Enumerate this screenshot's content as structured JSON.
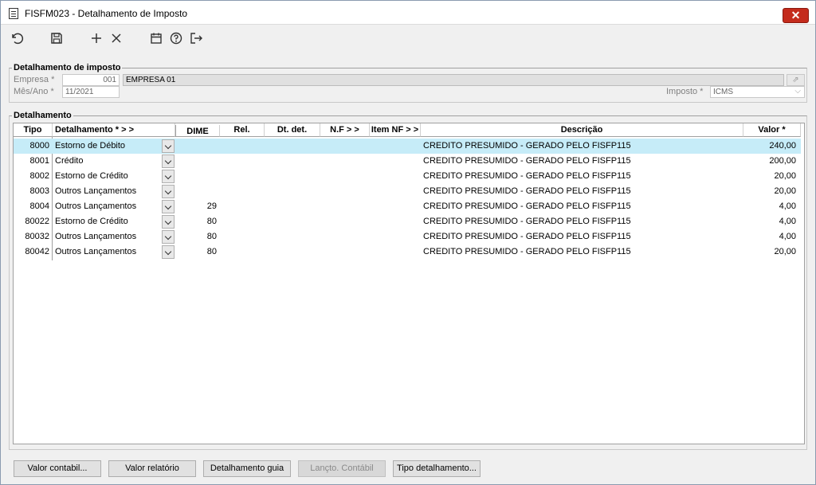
{
  "window": {
    "title": "FISFM023 - Detalhamento de Imposto",
    "close_label": "✕"
  },
  "toolbar": {
    "icons": [
      "undo-icon",
      "save-icon",
      "add-icon",
      "delete-icon",
      "calendar-icon",
      "help-icon",
      "exit-icon"
    ]
  },
  "header_group": {
    "legend": "Detalhamento de imposto",
    "empresa_label": "Empresa *",
    "empresa_code": "001",
    "empresa_name": "EMPRESA 01",
    "mes_ano_label": "Mês/Ano *",
    "mes_ano_value": "11/2021",
    "imposto_label": "Imposto *",
    "imposto_value": "ICMS"
  },
  "detail_group": {
    "legend": "Detalhamento",
    "columns": {
      "tipo": "Tipo",
      "detalhamento": "Detalhamento *  > >",
      "dime": "DIME",
      "rel": "Rel.",
      "dt_det": "Dt. det.",
      "nf": "N.F  > >",
      "item_nf": "Item NF > >",
      "descricao": "Descrição",
      "valor": "Valor *"
    },
    "rows": [
      {
        "tipo": "8000",
        "detalhamento": "Estorno de Débito",
        "dime": "",
        "descricao": "CREDITO PRESUMIDO - GERADO PELO FISFP115",
        "valor": "240,00"
      },
      {
        "tipo": "8001",
        "detalhamento": "Crédito",
        "dime": "",
        "descricao": "CREDITO PRESUMIDO - GERADO PELO FISFP115",
        "valor": "200,00"
      },
      {
        "tipo": "8002",
        "detalhamento": "Estorno de Crédito",
        "dime": "",
        "descricao": "CREDITO PRESUMIDO - GERADO PELO FISFP115",
        "valor": "20,00"
      },
      {
        "tipo": "8003",
        "detalhamento": "Outros Lançamentos",
        "dime": "",
        "descricao": "CREDITO PRESUMIDO - GERADO PELO FISFP115",
        "valor": "20,00"
      },
      {
        "tipo": "8004",
        "detalhamento": "Outros Lançamentos",
        "dime": "29",
        "descricao": "CREDITO PRESUMIDO - GERADO PELO FISFP115",
        "valor": "4,00"
      },
      {
        "tipo": "80022",
        "detalhamento": "Estorno de Crédito",
        "dime": "80",
        "descricao": "CREDITO PRESUMIDO - GERADO PELO FISFP115",
        "valor": "4,00"
      },
      {
        "tipo": "80032",
        "detalhamento": "Outros Lançamentos",
        "dime": "80",
        "descricao": "CREDITO PRESUMIDO - GERADO PELO FISFP115",
        "valor": "4,00"
      },
      {
        "tipo": "80042",
        "detalhamento": "Outros Lançamentos",
        "dime": "80",
        "descricao": "CREDITO PRESUMIDO - GERADO PELO FISFP115",
        "valor": "20,00"
      }
    ]
  },
  "buttons": {
    "valor_contabil": "Valor contabil...",
    "valor_relatorio": "Valor relatório",
    "detalhamento_guia": "Detalhamento guia",
    "lancto_contabil": "Lançto. Contábil",
    "tipo_detalhamento": "Tipo detalhamento..."
  },
  "colors": {
    "selected_row": "#c6ecf8",
    "close_button": "#c42b1c"
  }
}
